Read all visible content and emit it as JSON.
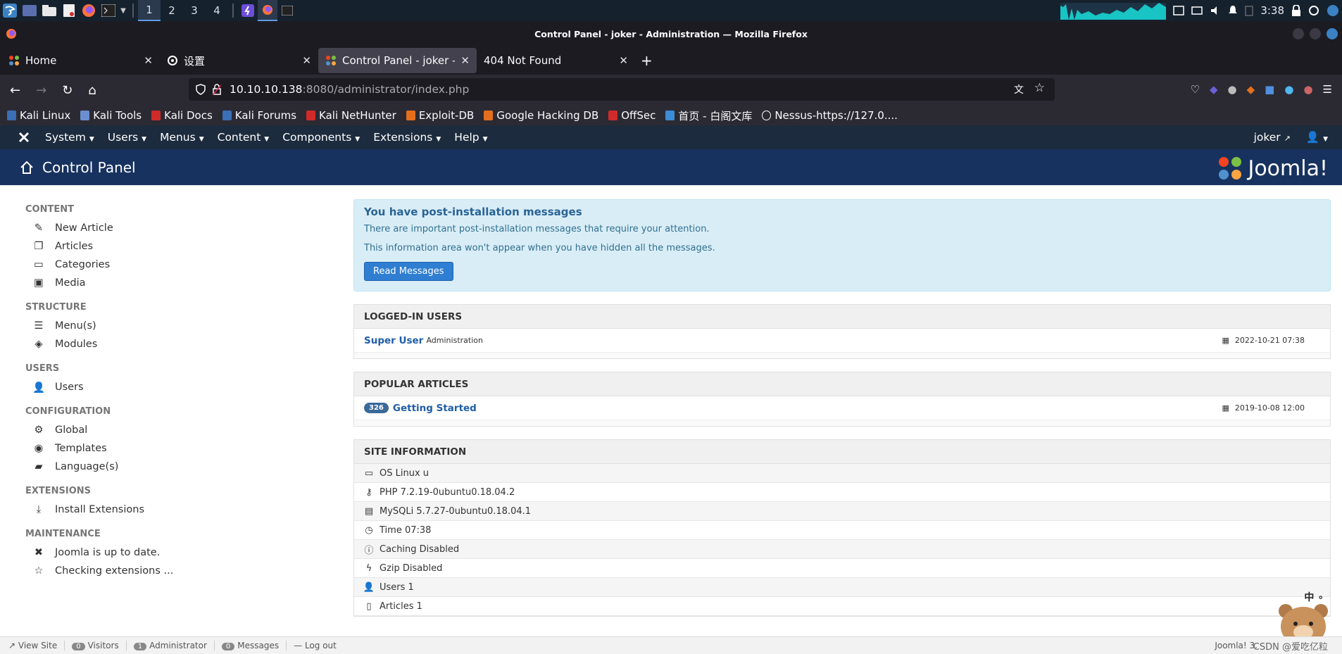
{
  "taskbar": {
    "workspaces": [
      "1",
      "2",
      "3",
      "4"
    ],
    "clock": "3:38"
  },
  "window": {
    "title": "Control Panel - joker - Administration — Mozilla Firefox"
  },
  "tabs": [
    {
      "label": "Home"
    },
    {
      "label": "设置"
    },
    {
      "label": "Control Panel - joker - Ad"
    },
    {
      "label": "404 Not Found"
    }
  ],
  "url": {
    "host": "10.10.10.138",
    "path": ":8080/administrator/index.php"
  },
  "bookmarks": [
    {
      "label": "Kali Linux",
      "color": "#3b6fb6"
    },
    {
      "label": "Kali Tools",
      "color": "#6a8fd0"
    },
    {
      "label": "Kali Docs",
      "color": "#d02b2b"
    },
    {
      "label": "Kali Forums",
      "color": "#3b6fb6"
    },
    {
      "label": "Kali NetHunter",
      "color": "#d02b2b"
    },
    {
      "label": "Exploit-DB",
      "color": "#e36f1e"
    },
    {
      "label": "Google Hacking DB",
      "color": "#e36f1e"
    },
    {
      "label": "OffSec",
      "color": "#d02b2b"
    },
    {
      "label": "首页 - 白阁文库",
      "color": "#3c8bd6"
    },
    {
      "label": "Nessus-https://127.0....",
      "color": "#ffffff"
    }
  ],
  "joomla": {
    "menu": [
      "System",
      "Users",
      "Menus",
      "Content",
      "Components",
      "Extensions",
      "Help"
    ],
    "user": "joker",
    "page_title": "Control Panel",
    "logo_text": "Joomla!"
  },
  "sidebar": {
    "content_title": "CONTENT",
    "new_article": "New Article",
    "articles": "Articles",
    "categories": "Categories",
    "media": "Media",
    "structure_title": "STRUCTURE",
    "menus": "Menu(s)",
    "modules": "Modules",
    "users_title": "USERS",
    "users": "Users",
    "config_title": "CONFIGURATION",
    "global": "Global",
    "templates": "Templates",
    "languages": "Language(s)",
    "extensions_title": "EXTENSIONS",
    "install_extensions": "Install Extensions",
    "maintenance_title": "MAINTENANCE",
    "uptodate": "Joomla is up to date.",
    "checking": "Checking extensions ..."
  },
  "alert": {
    "title": "You have post-installation messages",
    "line1": "There are important post-installation messages that require your attention.",
    "line2": "This information area won't appear when you have hidden all the messages.",
    "button": "Read Messages"
  },
  "logged_in": {
    "title": "LOGGED-IN USERS",
    "user": "Super User",
    "role": "Administration",
    "date": "2022-10-21 07:38"
  },
  "popular": {
    "title": "POPULAR ARTICLES",
    "hits": "326",
    "article": "Getting Started",
    "date": "2019-10-08 12:00"
  },
  "site_info": {
    "title": "SITE INFORMATION",
    "rows": [
      "OS Linux u",
      "PHP 7.2.19-0ubuntu0.18.04.2",
      "MySQLi 5.7.27-0ubuntu0.18.04.1",
      "Time 07:38",
      "Caching Disabled",
      "Gzip Disabled",
      "Users 1",
      "Articles 1"
    ]
  },
  "status": {
    "view_site": "View Site",
    "visitors_count": "0",
    "visitors": "Visitors",
    "admin_count": "1",
    "admin": "Administrator",
    "messages_count": "0",
    "messages": "Messages",
    "logout": "Log out",
    "version": "Joomla! 3.",
    "watermark": "CSDN @爱吃亿粒"
  },
  "ime": "中 ∘"
}
